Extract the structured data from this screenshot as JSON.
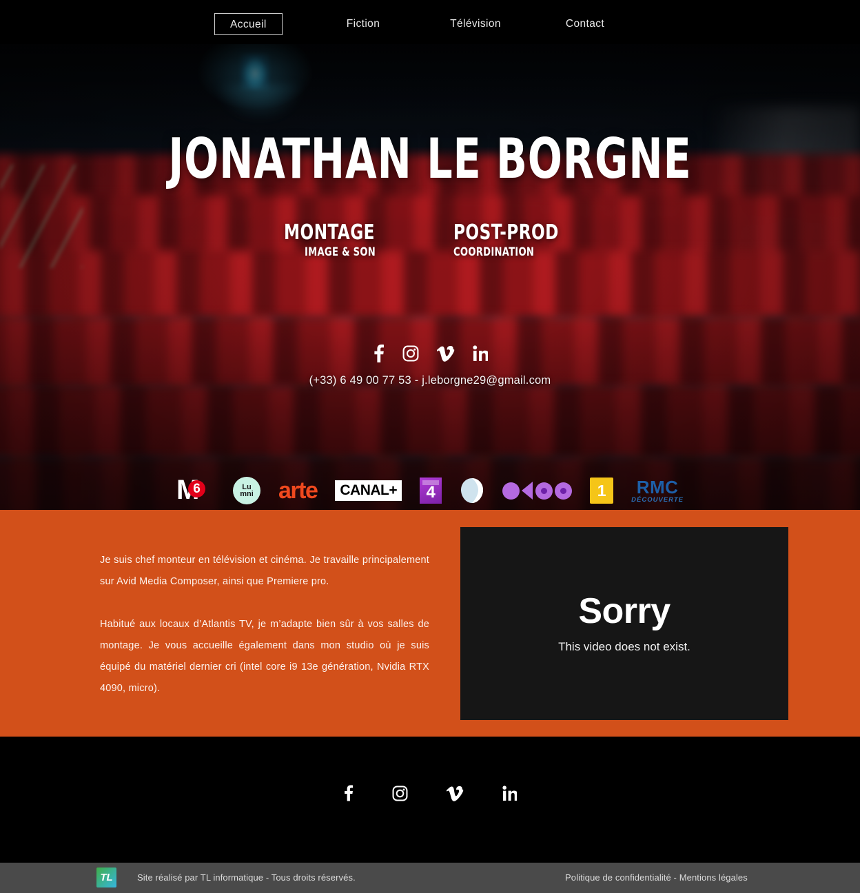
{
  "nav": {
    "items": [
      {
        "label": "Accueil",
        "active": true
      },
      {
        "label": "Fiction",
        "active": false
      },
      {
        "label": "Télévision",
        "active": false
      },
      {
        "label": "Contact",
        "active": false
      }
    ]
  },
  "hero": {
    "title": "JONATHAN  LE BORGNE",
    "roles": [
      {
        "main": "MONTAGE",
        "sub": "IMAGE & SON"
      },
      {
        "main": "POST-PROD",
        "sub": "COORDINATION"
      }
    ],
    "social": [
      {
        "name": "facebook-icon",
        "label": "Facebook"
      },
      {
        "name": "instagram-icon",
        "label": "Instagram"
      },
      {
        "name": "vimeo-icon",
        "label": "Vimeo"
      },
      {
        "name": "linkedin-icon",
        "label": "LinkedIn"
      }
    ],
    "contact": "(+33) 6 49 00 77 53 - j.leborgne29@gmail.com",
    "background_image": "cinema-audience-red-seats"
  },
  "logos": {
    "items": [
      {
        "name": "m6",
        "label": "M6"
      },
      {
        "name": "lumni",
        "label": "Lumni"
      },
      {
        "name": "arte",
        "label": "arte"
      },
      {
        "name": "canal-plus",
        "label": "CANAL+"
      },
      {
        "name": "france-4",
        "label": "4"
      },
      {
        "name": "salto",
        "label": "Salto"
      },
      {
        "name": "okoo",
        "label": "okoo"
      },
      {
        "name": "france-1",
        "label": "1"
      },
      {
        "name": "rmc-decouverte",
        "label": "RMC",
        "sub": "DÉCOUVERTE"
      }
    ]
  },
  "about": {
    "paragraphs": [
      "Je suis chef monteur en télévision et cinéma. Je travaille principalement sur Avid Media Composer, ainsi que Premiere pro.",
      "Habitué aux locaux d’Atlantis TV, je m’adapte bien sûr à vos salles de montage. Je vous accueille également dans mon studio où je suis équipé du matériel dernier cri (intel core i9 13e génération, Nvidia RTX 4090, micro)."
    ]
  },
  "video": {
    "title": "Sorry",
    "message": "This video does not exist."
  },
  "footer": {
    "social": [
      {
        "name": "facebook-icon",
        "label": "Facebook"
      },
      {
        "name": "instagram-icon",
        "label": "Instagram"
      },
      {
        "name": "vimeo-icon",
        "label": "Vimeo"
      },
      {
        "name": "linkedin-icon",
        "label": "LinkedIn"
      }
    ],
    "credit": "Site réalisé par TL informatique - Tous droits réservés.",
    "legal": "Politique de confidentialité - Mentions légales",
    "logo_text": "TL"
  },
  "colors": {
    "orange": "#d2501a",
    "black": "#000000",
    "video_panel": "#161616",
    "footer_bar": "#4a4a4a",
    "arte_orange": "#f0491e",
    "m6_red": "#e2001a",
    "okoo_purple": "#b46ae0",
    "rmc_blue": "#1d5fa8"
  }
}
